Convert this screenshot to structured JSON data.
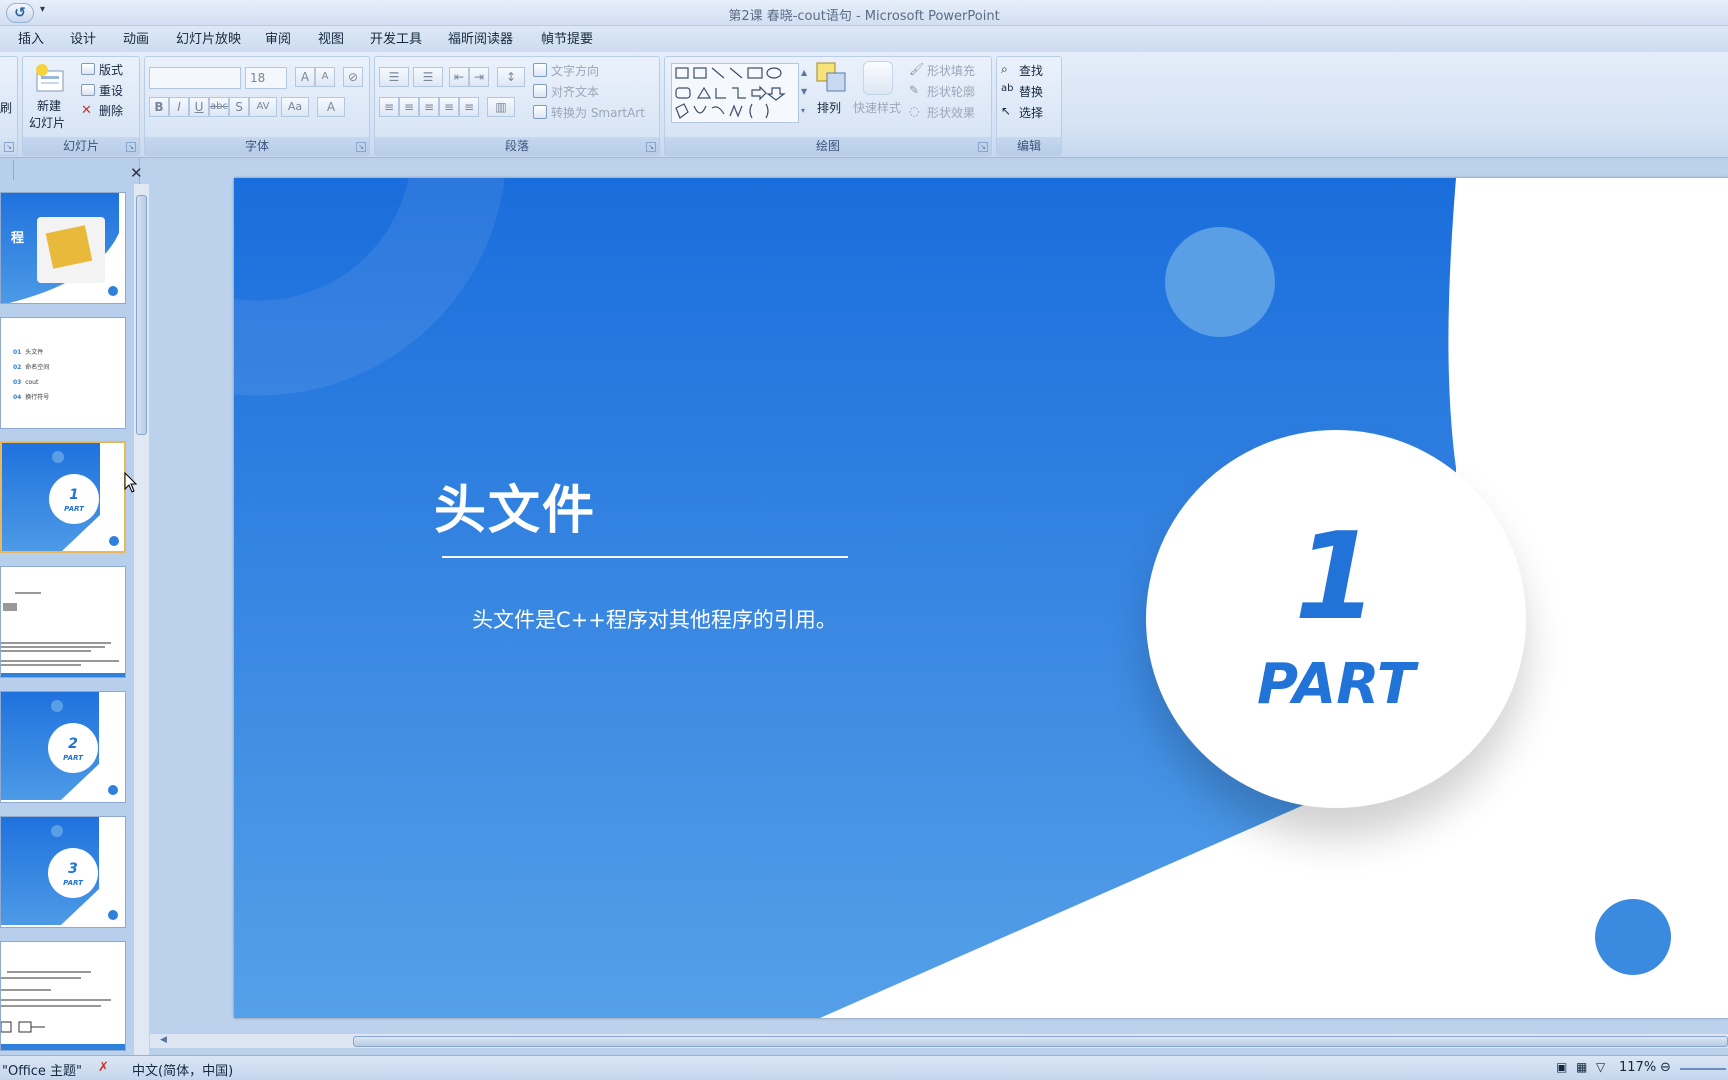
{
  "window": {
    "title": "第2课 春晓-cout语句 - Microsoft PowerPoint"
  },
  "qat": {
    "undo_glyph": "↺",
    "more_glyph": "▾"
  },
  "tabs": [
    "插入",
    "设计",
    "动画",
    "幻灯片放映",
    "审阅",
    "视图",
    "开发工具",
    "福昕阅读器",
    "幀节提要"
  ],
  "ribbon": {
    "slides_group": {
      "label": "幻灯片",
      "new_slide_line1": "新建",
      "new_slide_line2": "幻灯片",
      "layout": "版式",
      "reset": "重设",
      "delete": "删除",
      "clipboard_cut": "刷"
    },
    "font_group": {
      "label": "字体",
      "font_size": "18"
    },
    "paragraph_group": {
      "label": "段落",
      "text_direction": "文字方向",
      "align_text": "对齐文本",
      "convert_smartart": "转换为 SmartArt"
    },
    "drawing_group": {
      "label": "绘图",
      "arrange": "排列",
      "quick_styles": "快速样式",
      "shape_fill": "形状填充",
      "shape_outline": "形状轮廓",
      "shape_effects": "形状效果"
    },
    "editing_group": {
      "label": "编辑",
      "find": "查找",
      "replace": "替换",
      "select": "选择"
    }
  },
  "thumbnails": [
    {
      "index": 1,
      "title": "程",
      "selected": false
    },
    {
      "index": 2,
      "items": [
        "头文件",
        "命名空间",
        "cout",
        "换行符号"
      ],
      "selected": false
    },
    {
      "index": 3,
      "part_num": "1",
      "part_word": "PART",
      "selected": true
    },
    {
      "index": 4,
      "selected": false
    },
    {
      "index": 5,
      "part_num": "2",
      "part_word": "PART",
      "selected": false
    },
    {
      "index": 6,
      "part_num": "3",
      "part_word": "PART",
      "selected": false
    },
    {
      "index": 7,
      "selected": false
    }
  ],
  "slide": {
    "title": "头文件",
    "body": "头文件是C++程序对其他程序的引用。",
    "part_number": "1",
    "part_word": "PART",
    "colors": {
      "blue_top": "#1f72dd",
      "blue_bottom": "#4d9ae6",
      "accent": "#2273d8",
      "soft_circle": "#5a9fe5"
    }
  },
  "statusbar": {
    "theme": "\"Office 主题\"",
    "language": "中文(简体，中国)",
    "zoom": "117%"
  }
}
